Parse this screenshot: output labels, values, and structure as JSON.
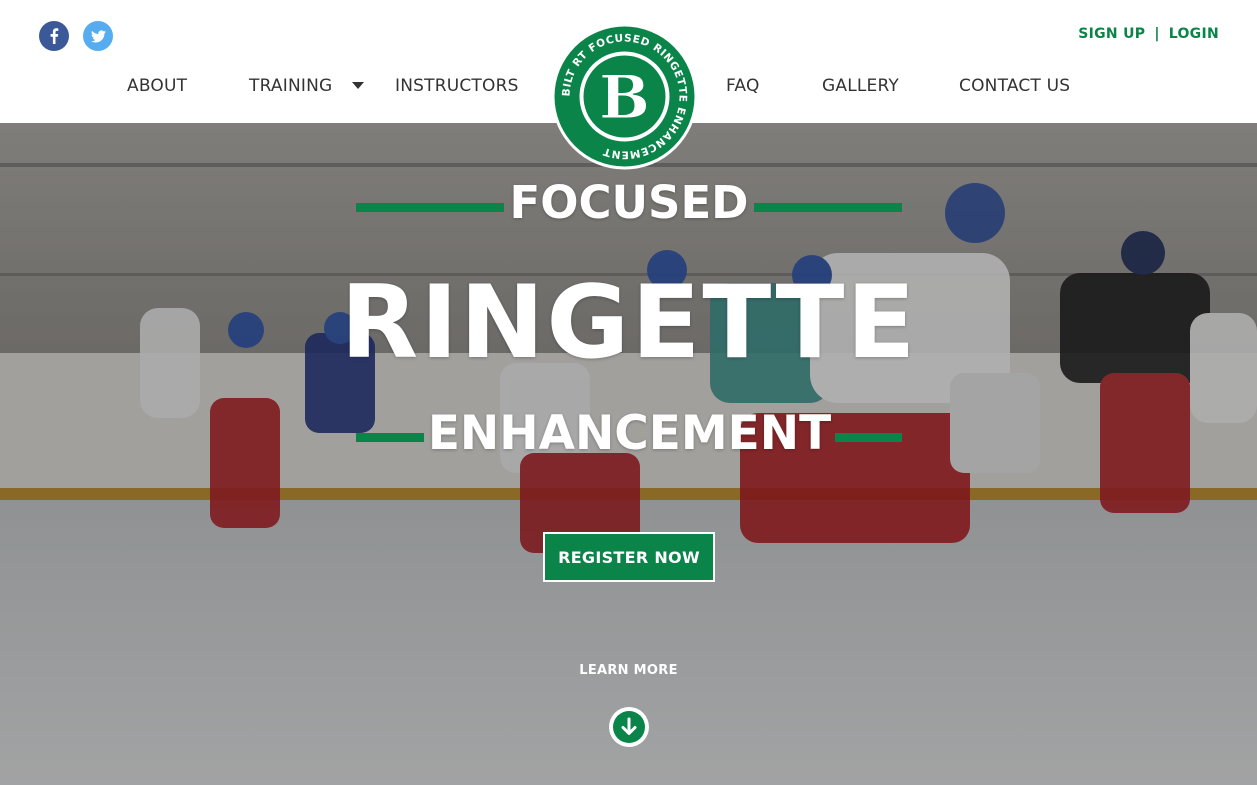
{
  "brand": {
    "logo_letter": "B",
    "logo_ring_text": "BILT RT FOCUSED RINGETTE ENHANCEMENT",
    "accent_color": "#0a8448"
  },
  "social": {
    "facebook_icon": "facebook-icon",
    "twitter_icon": "twitter-icon"
  },
  "auth": {
    "signup": "SIGN UP",
    "separator": "|",
    "login": "LOGIN"
  },
  "nav": {
    "about": "ABOUT",
    "training": "TRAINING",
    "instructors": "INSTRUCTORS",
    "faq": "FAQ",
    "gallery": "GALLERY",
    "contact": "CONTACT US"
  },
  "hero": {
    "line1": "FOCUSED",
    "line2": "RINGETTE",
    "line3": "ENHANCEMENT",
    "cta": "REGISTER NOW",
    "learn_more": "LEARN MORE",
    "down_icon": "arrow-down-circle-icon"
  }
}
